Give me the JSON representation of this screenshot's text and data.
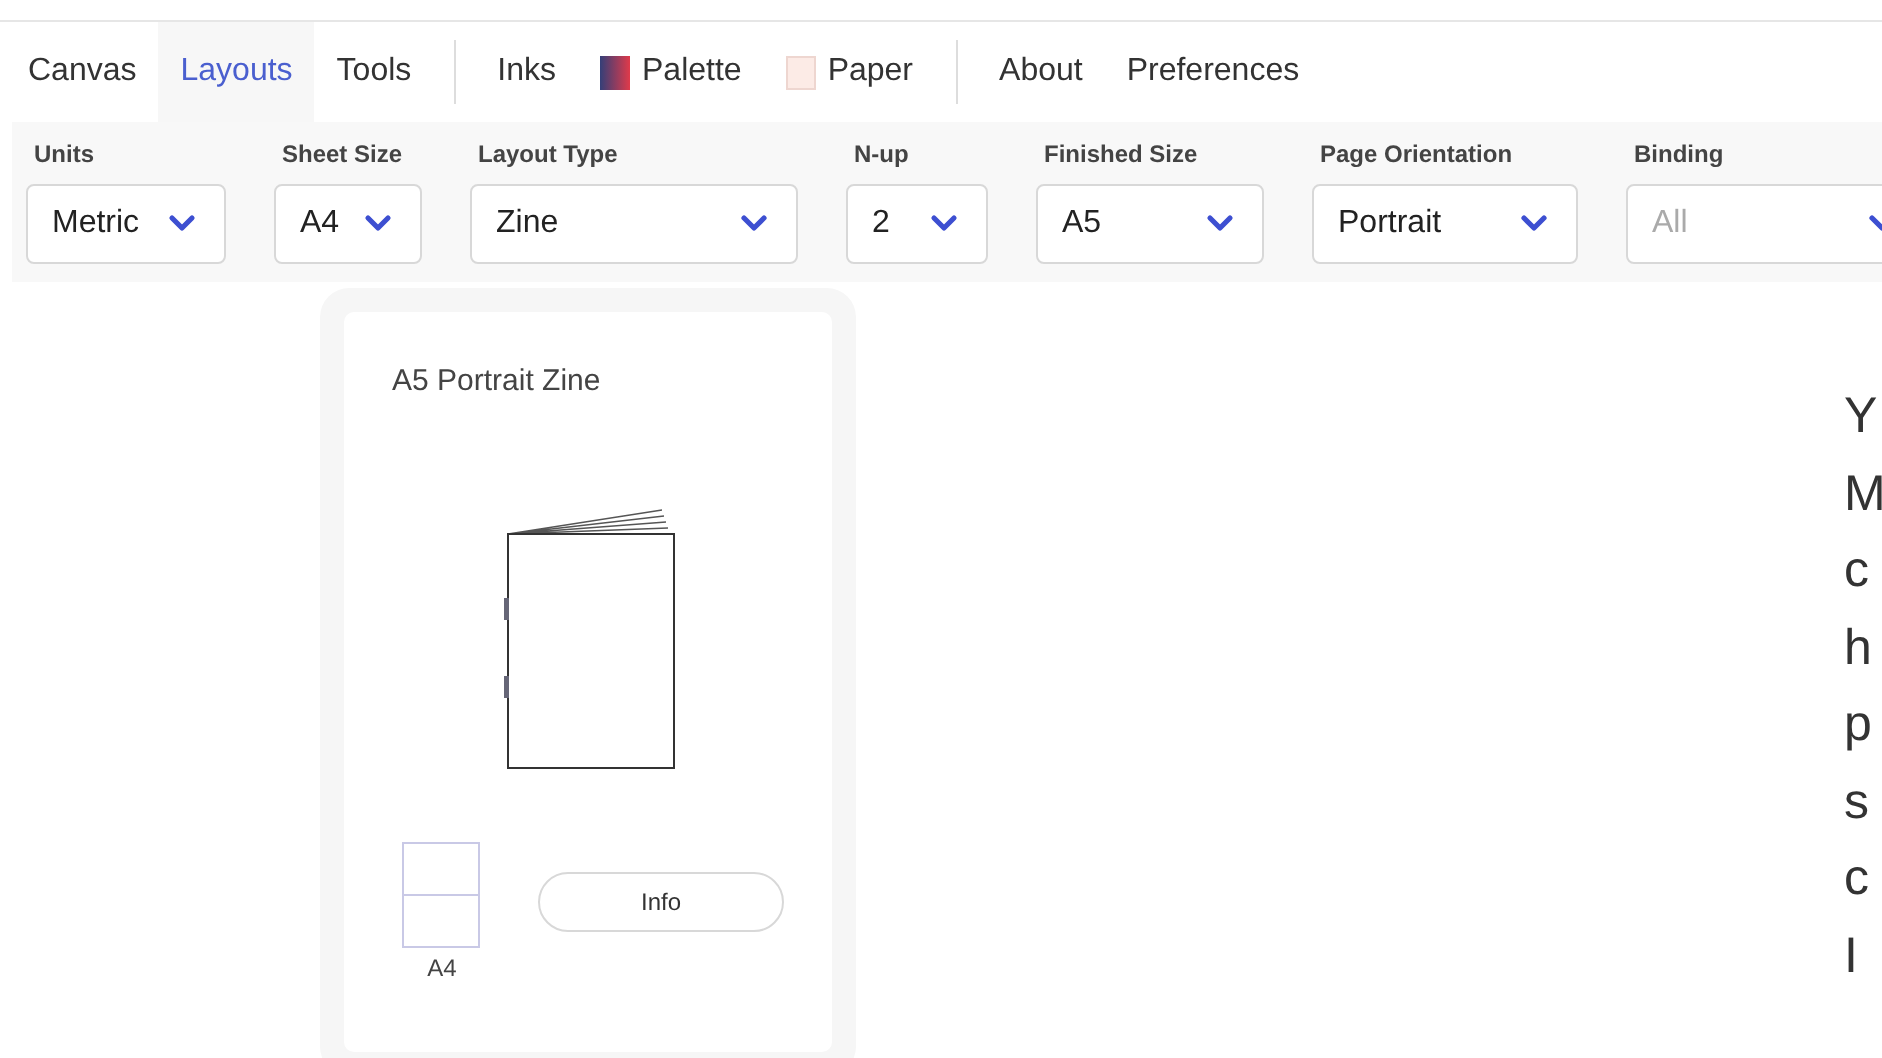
{
  "nav": {
    "tab_groups": [
      [
        {
          "label": "Canvas",
          "selected": false,
          "kind": "plain"
        },
        {
          "label": "Layouts",
          "selected": true,
          "kind": "plain"
        },
        {
          "label": "Tools",
          "selected": false,
          "kind": "plain"
        }
      ],
      [
        {
          "label": "Inks",
          "selected": false,
          "kind": "plain"
        },
        {
          "label": "Palette",
          "selected": false,
          "kind": "palette"
        },
        {
          "label": "Paper",
          "selected": false,
          "kind": "paper"
        }
      ],
      [
        {
          "label": "About",
          "selected": false,
          "kind": "plain"
        },
        {
          "label": "Preferences",
          "selected": false,
          "kind": "plain"
        }
      ]
    ]
  },
  "filters": [
    {
      "label": "Units",
      "value": "Metric"
    },
    {
      "label": "Sheet Size",
      "value": "A4"
    },
    {
      "label": "Layout Type",
      "value": "Zine"
    },
    {
      "label": "N-up",
      "value": "2"
    },
    {
      "label": "Finished Size",
      "value": "A5"
    },
    {
      "label": "Page Orientation",
      "value": "Portrait"
    },
    {
      "label": "Binding",
      "placeholder": "All"
    }
  ],
  "card": {
    "title": "A5 Portrait Zine",
    "sheet_label": "A4",
    "button": "Info"
  },
  "side_text": [
    "Y",
    "M",
    "c",
    "h",
    "p",
    "s",
    "c",
    "I"
  ]
}
